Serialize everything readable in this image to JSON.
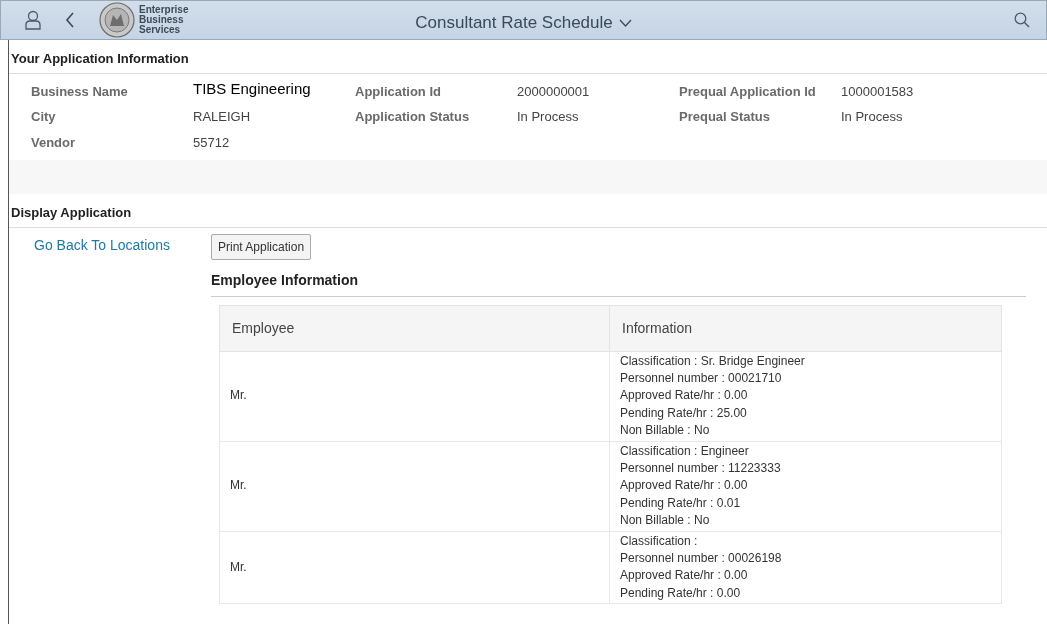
{
  "header": {
    "logo_lines": [
      "Enterprise",
      "Business",
      "Services"
    ],
    "title": "Consultant Rate Schedule"
  },
  "application_info": {
    "title": "Your Application Information",
    "rows": [
      [
        {
          "label": "Business Name",
          "value": "TIBS Engineering",
          "emphasized": true
        },
        {
          "label": "Application Id",
          "value": "2000000001",
          "emphasized": false
        },
        {
          "label": "Prequal Application Id",
          "value": "1000001583",
          "emphasized": false
        }
      ],
      [
        {
          "label": "City",
          "value": "RALEIGH",
          "emphasized": false
        },
        {
          "label": "Application Status",
          "value": "In Process",
          "emphasized": false
        },
        {
          "label": "Prequal Status",
          "value": "In Process",
          "emphasized": false
        }
      ],
      [
        {
          "label": "Vendor",
          "value": "55712",
          "emphasized": false
        }
      ]
    ]
  },
  "display": {
    "title": "Display Application",
    "back_link": "Go Back To Locations",
    "print_button": "Print Application",
    "section_title": "Employee Information",
    "table": {
      "columns": [
        "Employee",
        "Information"
      ],
      "rows": [
        {
          "employee": "Mr.",
          "info": [
            "Classification : Sr. Bridge Engineer",
            "Personnel number : 00021710",
            "Approved Rate/hr : 0.00",
            "Pending Rate/hr : 25.00",
            "Non Billable : No"
          ]
        },
        {
          "employee": "Mr.",
          "info": [
            "Classification : Engineer",
            "Personnel number : 11223333",
            "Approved Rate/hr : 0.00",
            "Pending Rate/hr : 0.01",
            "Non Billable : No"
          ]
        },
        {
          "employee": "Mr.",
          "info": [
            "Classification :",
            "Personnel number : 00026198",
            "Approved Rate/hr : 0.00",
            "Pending Rate/hr : 0.00"
          ]
        }
      ]
    }
  }
}
